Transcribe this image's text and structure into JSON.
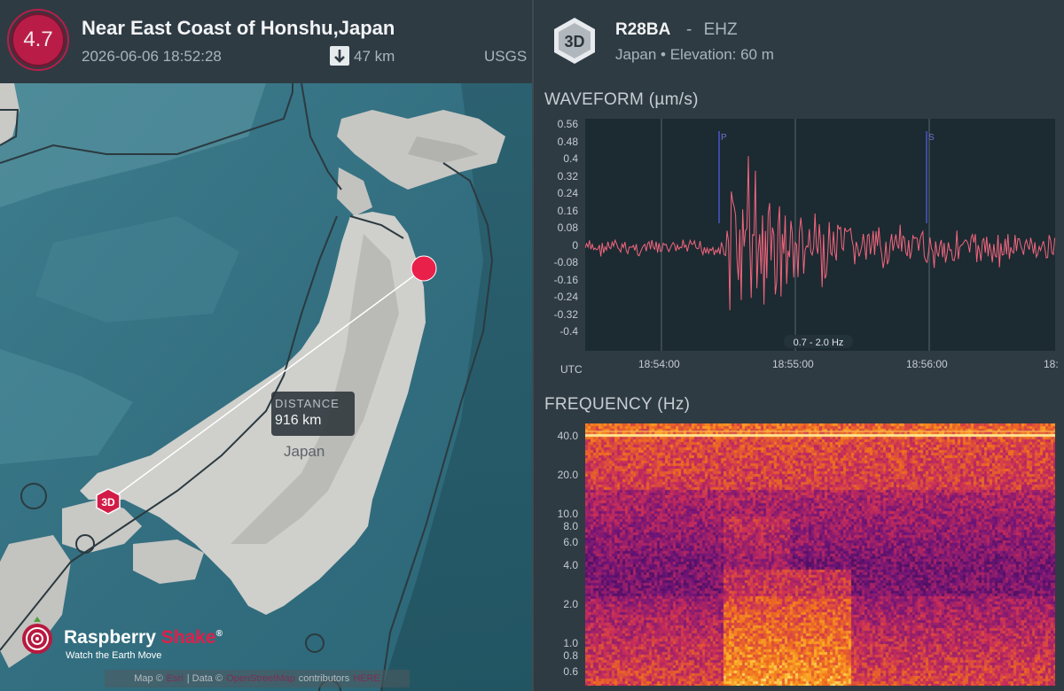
{
  "event": {
    "magnitude": "4.7",
    "title": "Near East Coast of Honshu,Japan",
    "datetime": "2026-06-06 18:52:28",
    "depth": "47 km",
    "source": "USGS",
    "color": "#b91d47"
  },
  "map": {
    "distance_label": "DISTANCE",
    "distance_value": "916 km",
    "country_label": "Japan",
    "station_marker": "3D",
    "brand_name_1": "Raspberry",
    "brand_name_2": "Shake",
    "brand_reg": "®",
    "brand_tagline": "Watch the Earth Move",
    "credits_prefix": "Map ©",
    "credits_link1": "Esri",
    "credits_mid": "| Data ©",
    "credits_link2": "OpenStreetMap",
    "credits_suffix": "contributors",
    "credits_link3": "HERE",
    "icons": [
      "distance-line",
      "epicenter-marker",
      "station-marker",
      "depth-arrow-icon",
      "raspberry-shake-logo-icon"
    ]
  },
  "station": {
    "badge": "3D",
    "name": "R28BA",
    "separator": "-",
    "channel": "EHZ",
    "location": "Japan • Elevation: 60 m"
  },
  "waveform": {
    "title": "WAVEFORM (µm/s)",
    "filter_label": "0.7 - 2.0 Hz",
    "utc_label": "UTC",
    "p_label": "P",
    "s_label": "S",
    "y_ticks": [
      "0.56",
      "0.48",
      "0.4",
      "0.32",
      "0.24",
      "0.16",
      "0.08",
      "0",
      "-0.08",
      "-0.16",
      "-0.24",
      "-0.32",
      "-0.4"
    ],
    "x_ticks": [
      "18:54:00",
      "18:55:00",
      "18:56:00",
      "18:"
    ],
    "line_color": "#f2667e"
  },
  "frequency": {
    "title": "FREQUENCY (Hz)",
    "y_ticks": [
      "40.0",
      "20.0",
      "10.0",
      "8.0",
      "6.0",
      "4.0",
      "2.0",
      "1.0",
      "0.8",
      "0.6"
    ]
  }
}
